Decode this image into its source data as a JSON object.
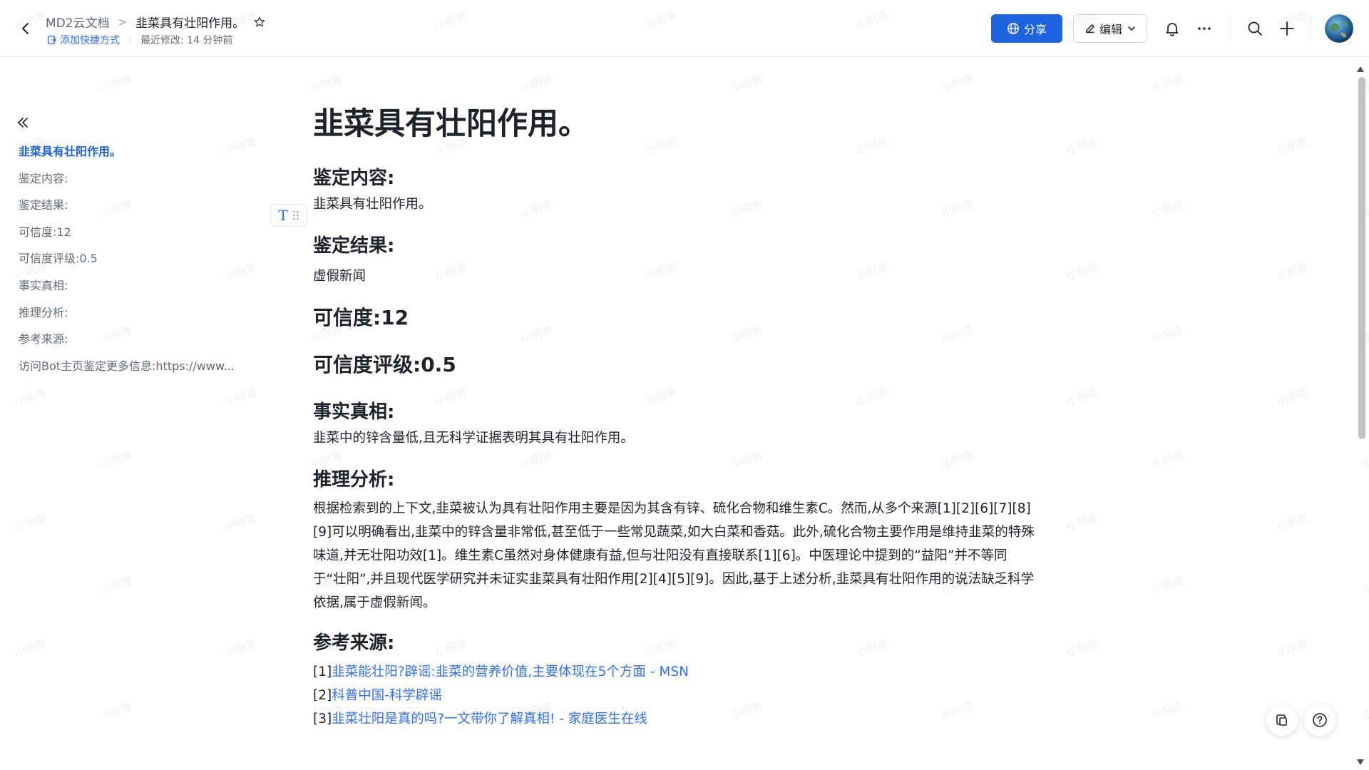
{
  "header": {
    "breadcrumb_root": "MD2云文档",
    "breadcrumb_sep": ">",
    "doc_title": "韭菜具有壮阳作用。",
    "add_shortcut": "添加快捷方式",
    "last_modified": "最近修改: 14 分钟前",
    "share_label": "分享",
    "edit_label": "编辑"
  },
  "outline": {
    "items": [
      "韭菜具有壮阳作用。",
      "鉴定内容:",
      "鉴定结果:",
      "可信度:12",
      "可信度评级:0.5",
      "事实真相:",
      "推理分析:",
      "参考来源:",
      "访问Bot主页鉴定更多信息:https://www..."
    ]
  },
  "doc": {
    "title": "韭菜具有壮阳作用。",
    "content_heading": "鉴定内容:",
    "content_text": "韭菜具有壮阳作用。",
    "result_heading": "鉴定结果:",
    "result_text": "虚假新闻",
    "credibility": "可信度:12",
    "credibility_rating": "可信度评级:0.5",
    "facts_heading": "事实真相:",
    "facts_text": "韭菜中的锌含量低,且无科学证据表明其具有壮阳作用。",
    "analysis_heading": "推理分析:",
    "analysis_text": "根据检索到的上下文,韭菜被认为具有壮阳作用主要是因为其含有锌、硫化合物和维生素C。然而,从多个来源[1][2][6][7][8][9]可以明确看出,韭菜中的锌含量非常低,甚至低于一些常见蔬菜,如大白菜和香菇。此外,硫化合物主要作用是维持韭菜的特殊味道,并无壮阳功效[1]。维生素C虽然对身体健康有益,但与壮阳没有直接联系[1][6]。中医理论中提到的“益阳”并不等同于“壮阳”,并且现代医学研究并未证实韭菜具有壮阳作用[2][4][5][9]。因此,基于上述分析,韭菜具有壮阳作用的说法缺乏科学依据,属于虚假新闻。",
    "sources_heading": "参考来源:",
    "sources": [
      {
        "num": "[1]",
        "title": "韭菜能壮阳?辟谣:韭菜的营养价值,主要体现在5个方面 - MSN"
      },
      {
        "num": "[2]",
        "title": "科普中国-科学辟谣"
      },
      {
        "num": "[3]",
        "title": "韭菜壮阳是真的吗?一文带你了解真相! - 家庭医生在线"
      }
    ]
  },
  "watermark": "小明哥",
  "colors": {
    "accent": "#1d63e0",
    "link": "#3370ff",
    "text": "#1f2329",
    "muted": "#646a73"
  },
  "icons": {
    "back": "chevron-left-icon",
    "star": "star-icon",
    "shortcut": "shortcut-icon",
    "share": "globe-icon",
    "edit": "pencil-icon",
    "bell": "bell-icon",
    "more": "more-icon",
    "search": "search-icon",
    "add": "plus-icon",
    "collapse": "double-chevron-left-icon",
    "text_block": "text-block-icon",
    "drag": "drag-handle-icon",
    "fab_left": "copy-icon",
    "fab_right": "help-icon"
  }
}
